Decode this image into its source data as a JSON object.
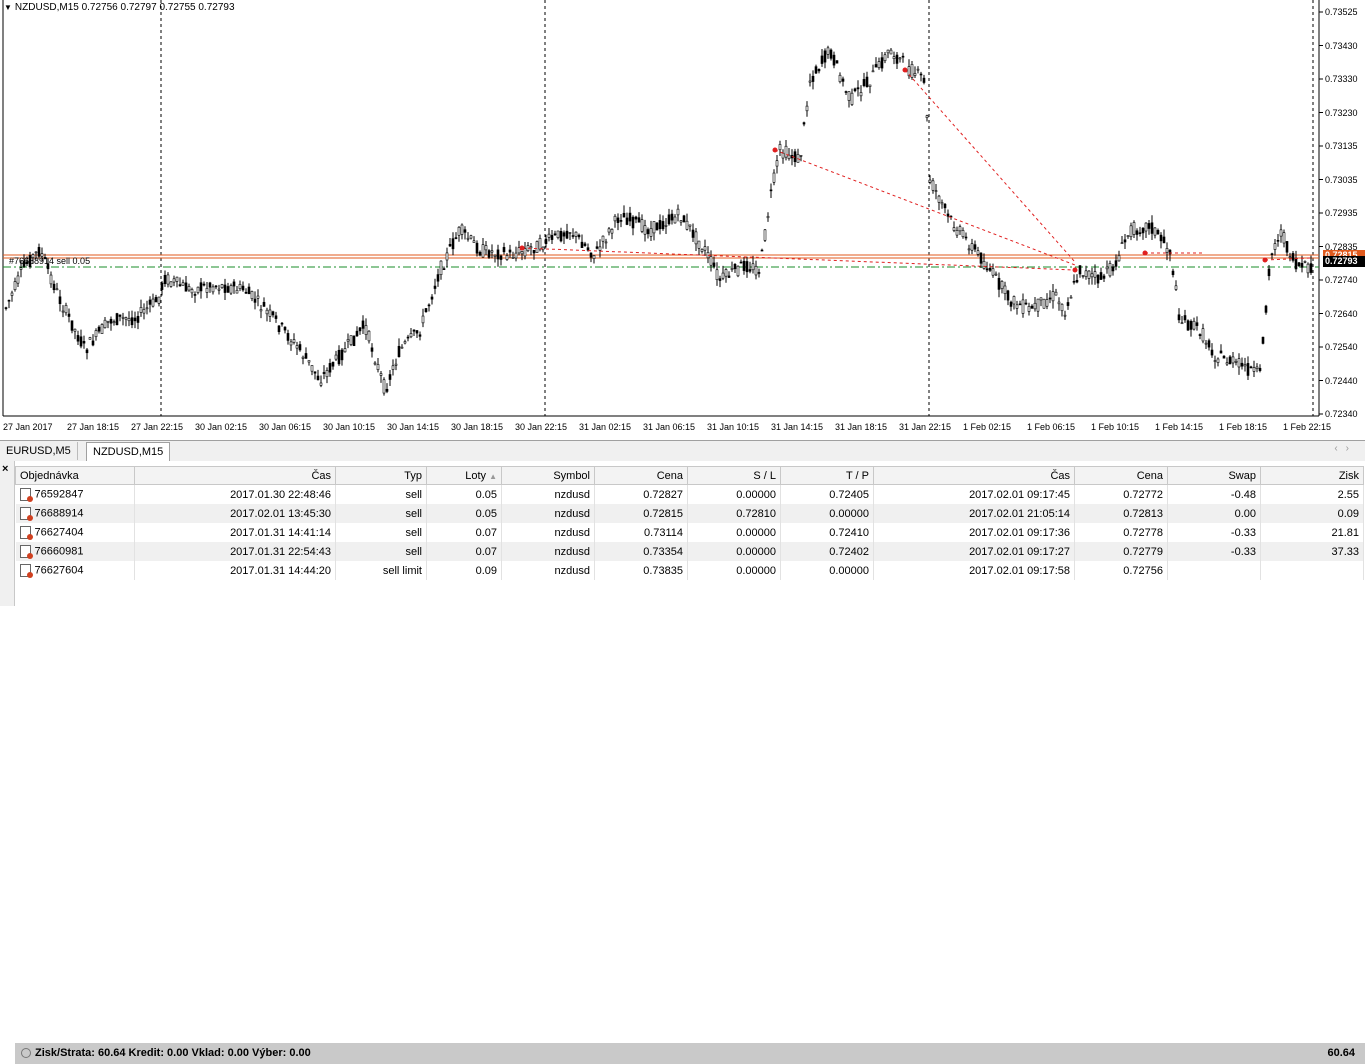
{
  "chart": {
    "symbol_line": "NZDUSD,M15  0.72756 0.72797 0.72755 0.72793",
    "order_label": "#76688914 sell 0.05",
    "current_price": "0.72793",
    "order_price": "0.72815",
    "price_ticks": [
      "0.73525",
      "0.73430",
      "0.73330",
      "0.73230",
      "0.73135",
      "0.73035",
      "0.72935",
      "0.72835",
      "0.72740",
      "0.72640",
      "0.72540",
      "0.72440",
      "0.72340"
    ],
    "time_ticks": [
      "27 Jan 2017",
      "27 Jan 18:15",
      "27 Jan 22:15",
      "30 Jan 02:15",
      "30 Jan 06:15",
      "30 Jan 10:15",
      "30 Jan 14:15",
      "30 Jan 18:15",
      "30 Jan 22:15",
      "31 Jan 02:15",
      "31 Jan 06:15",
      "31 Jan 10:15",
      "31 Jan 14:15",
      "31 Jan 18:15",
      "31 Jan 22:15",
      "1 Feb 02:15",
      "1 Feb 06:15",
      "1 Feb 10:15",
      "1 Feb 14:15",
      "1 Feb 18:15",
      "1 Feb 22:15"
    ],
    "colors": {
      "order_line": "#e05a1e",
      "current_line": "#1a8c2a",
      "trade_line": "#e02020",
      "price_box": "#e05a1e",
      "bid_box": "#000000"
    }
  },
  "tabs": [
    {
      "label": "EURUSD,M5",
      "active": false
    },
    {
      "label": "NZDUSD,M15",
      "active": true
    }
  ],
  "table": {
    "headers": [
      "Objednávka",
      "Čas",
      "Typ",
      "Loty",
      "Symbol",
      "Cena",
      "S / L",
      "T / P",
      "Čas",
      "Cena",
      "Swap",
      "Zisk"
    ],
    "rows": [
      [
        "76592847",
        "2017.01.30 22:48:46",
        "sell",
        "0.05",
        "nzdusd",
        "0.72827",
        "0.00000",
        "0.72405",
        "2017.02.01 09:17:45",
        "0.72772",
        "-0.48",
        "2.55"
      ],
      [
        "76688914",
        "2017.02.01 13:45:30",
        "sell",
        "0.05",
        "nzdusd",
        "0.72815",
        "0.72810",
        "0.00000",
        "2017.02.01 21:05:14",
        "0.72813",
        "0.00",
        "0.09"
      ],
      [
        "76627404",
        "2017.01.31 14:41:14",
        "sell",
        "0.07",
        "nzdusd",
        "0.73114",
        "0.00000",
        "0.72410",
        "2017.02.01 09:17:36",
        "0.72778",
        "-0.33",
        "21.81"
      ],
      [
        "76660981",
        "2017.01.31 22:54:43",
        "sell",
        "0.07",
        "nzdusd",
        "0.73354",
        "0.00000",
        "0.72402",
        "2017.02.01 09:17:27",
        "0.72779",
        "-0.33",
        "37.33"
      ],
      [
        "76627604",
        "2017.01.31 14:44:20",
        "sell limit",
        "0.09",
        "nzdusd",
        "0.73835",
        "0.00000",
        "0.00000",
        "2017.02.01 09:17:58",
        "0.72756",
        "",
        ""
      ]
    ]
  },
  "summary": {
    "text": "Zisk/Strata: 60.64  Kredit: 0.00  Vklad: 0.00  Výber: 0.00",
    "total": "60.64"
  }
}
